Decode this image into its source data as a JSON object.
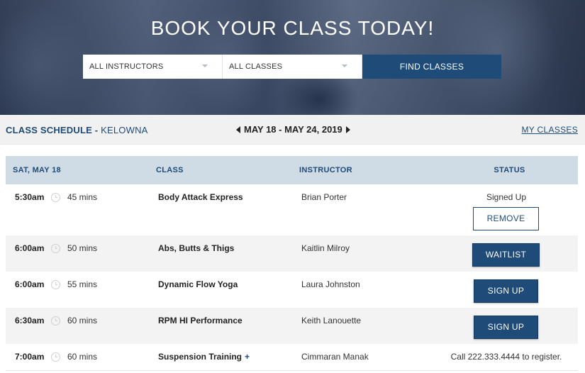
{
  "hero": {
    "title": "BOOK YOUR CLASS TODAY!",
    "instructor_select": "ALL INSTRUCTORS",
    "class_select": "ALL CLASSES",
    "find_button": "FIND CLASSES"
  },
  "schedule": {
    "title": "CLASS SCHEDULE",
    "separator": " - ",
    "location": "KELOWNA",
    "date_range": "MAY 18 - MAY 24, 2019",
    "my_classes": "MY CLASSES"
  },
  "table": {
    "headers": {
      "date": "SAT, MAY 18",
      "class": "CLASS",
      "instructor": "INSTRUCTOR",
      "status": "STATUS"
    },
    "rows": [
      {
        "time": "5:30am",
        "duration": "45 mins",
        "class": "Body Attack Express",
        "instructor": "Brian Porter",
        "status_text": "Signed Up",
        "button": "REMOVE"
      },
      {
        "time": "6:00am",
        "duration": "50 mins",
        "class": "Abs, Butts & Thigs",
        "instructor": "Kaitlin Milroy",
        "button": "WAITLIST"
      },
      {
        "time": "6:00am",
        "duration": "55 mins",
        "class": "Dynamic Flow Yoga",
        "instructor": "Laura Johnston",
        "button": "SIGN UP"
      },
      {
        "time": "6:30am",
        "duration": "60 mins",
        "class": "RPM HI Performance",
        "instructor": "Keith Lanouette",
        "button": "SIGN UP"
      },
      {
        "time": "7:00am",
        "duration": "60 mins",
        "class": "Suspension Training",
        "class_plus": "+",
        "instructor": "Cimmaran Manak",
        "status_text": "Call 222.333.4444 to register."
      }
    ]
  },
  "colors": {
    "primary": "#1e4b78",
    "header_bg": "#cfdbe5",
    "alt_row": "#f3f3f3"
  },
  "icons": [
    "caret-down-icon",
    "arrow-left-icon",
    "arrow-right-icon",
    "clock-icon"
  ]
}
